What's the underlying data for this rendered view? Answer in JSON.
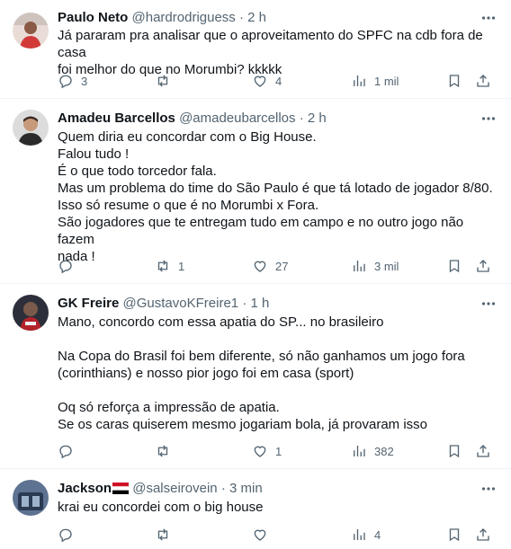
{
  "tweets": [
    {
      "name": "Paulo Neto",
      "handle": "@hardrodriguess",
      "dot": "·",
      "time": "2 h",
      "lines": [
        "Já pararam pra analisar que o aproveitamento do SPFC na cdb fora de casa",
        "foi melhor do que no Morumbi? kkkkk"
      ],
      "replies": "3",
      "retweets": "",
      "likes": "4",
      "views": "1 mil"
    },
    {
      "name": "Amadeu Barcellos",
      "handle": "@amadeubarcellos",
      "dot": "·",
      "time": "2 h",
      "lines": [
        "Quem diria eu concordar com o Big House.",
        "Falou tudo !",
        "É o que todo torcedor fala.",
        "Mas um problema do time do São Paulo é que tá lotado de jogador 8/80.",
        "Isso só resume o que é no Morumbi x Fora.",
        "São jogadores que te entregam tudo em campo e no outro jogo não fazem",
        "nada !"
      ],
      "replies": "",
      "retweets": "1",
      "likes": "27",
      "views": "3 mil"
    },
    {
      "name": "GK Freire",
      "handle": "@GustavoKFreire1",
      "dot": "·",
      "time": "1 h",
      "lines": [
        "Mano, concordo com essa apatia do SP... no brasileiro",
        "",
        "Na Copa do Brasil foi bem diferente, só não ganhamos um jogo fora",
        "(corinthians) e nosso pior jogo foi em casa (sport)",
        "",
        "Oq só reforça a impressão de apatia.",
        "Se os caras quiserem mesmo jogariam bola, já provaram isso"
      ],
      "replies": "",
      "retweets": "",
      "likes": "1",
      "views": "382"
    },
    {
      "name": "Jackson",
      "handle": "@salseirovein",
      "dot": "·",
      "time": "3 min",
      "lines": [
        "krai eu concordei com o big house"
      ],
      "replies": "",
      "retweets": "",
      "likes": "",
      "views": "4"
    }
  ],
  "colors": {
    "text": "#0f1419",
    "muted": "#536471",
    "divider": "#eff3f4"
  },
  "icons": [
    "reply-icon",
    "retweet-icon",
    "like-icon",
    "views-icon",
    "bookmark-icon",
    "share-icon",
    "more-icon",
    "flag-icon"
  ]
}
